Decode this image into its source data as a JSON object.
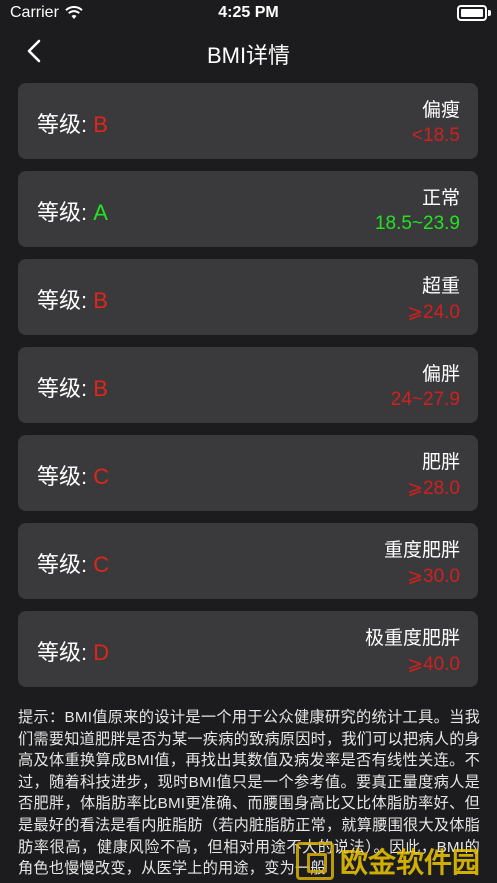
{
  "status": {
    "carrier": "Carrier",
    "time": "4:25 PM"
  },
  "nav": {
    "title": "BMI详情"
  },
  "grade_label": "等级: ",
  "levels": [
    {
      "grade": "B",
      "type": "偏瘦",
      "range": "<18.5",
      "grade_color": "#e0251b",
      "range_color": "#d21f1f"
    },
    {
      "grade": "A",
      "type": "正常",
      "range": "18.5~23.9",
      "grade_color": "#22e322",
      "range_color": "#22e322"
    },
    {
      "grade": "B",
      "type": "超重",
      "range": "⩾24.0",
      "grade_color": "#e0251b",
      "range_color": "#d21f1f"
    },
    {
      "grade": "B",
      "type": "偏胖",
      "range": "24~27.9",
      "grade_color": "#e0251b",
      "range_color": "#d21f1f"
    },
    {
      "grade": "C",
      "type": "肥胖",
      "range": "⩾28.0",
      "grade_color": "#e0251b",
      "range_color": "#d21f1f"
    },
    {
      "grade": "C",
      "type": "重度肥胖",
      "range": "⩾30.0",
      "grade_color": "#e0251b",
      "range_color": "#d21f1f"
    },
    {
      "grade": "D",
      "type": "极重度肥胖",
      "range": "⩾40.0",
      "grade_color": "#e0251b",
      "range_color": "#d21f1f"
    }
  ],
  "tip": "提示：BMI值原来的设计是一个用于公众健康研究的统计工具。当我们需要知道肥胖是否为某一疾病的致病原因时，我们可以把病人的身高及体重换算成BMI值，再找出其数值及病发率是否有线性关连。不过，随着科技进步，现时BMI值只是一个参考值。要真正量度病人是否肥胖，体脂肪率比BMI更准确、而腰围身高比又比体脂肪率好、但是最好的看法是看内脏脂肪（若内脏脂肪正常，就算腰围很大及体脂肪率很高，健康风险不高，但相对用途不大的说法）。因此，BMI的角色也慢慢改变，从医学上的用途，变为一般",
  "watermark": {
    "text": "欧金软件园"
  }
}
